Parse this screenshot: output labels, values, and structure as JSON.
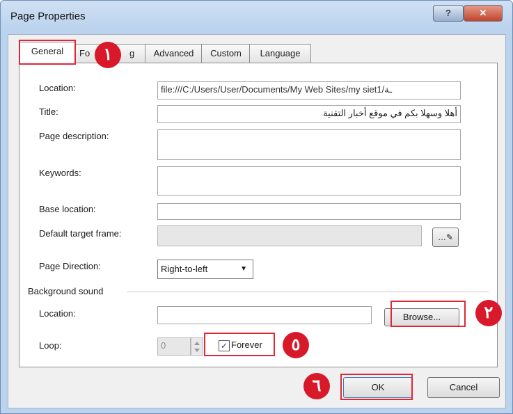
{
  "window": {
    "title": "Page Properties",
    "help_glyph": "?",
    "close_glyph": "✕"
  },
  "tabs": [
    {
      "label": "General"
    },
    {
      "label": "Formatting",
      "visible": "Fo"
    },
    {
      "label": "g"
    },
    {
      "label": "Advanced"
    },
    {
      "label": "Custom"
    },
    {
      "label": "Language"
    }
  ],
  "general": {
    "location_label": "Location:",
    "location_value": "file:///C:/Users/User/Documents/My Web Sites/my siet1/ـة",
    "title_label": "Title:",
    "title_value": "أهلا وسهلا بكم في موقع أخبار التقنية",
    "description_label": "Page description:",
    "description_value": "",
    "keywords_label": "Keywords:",
    "keywords_value": "",
    "base_label": "Base location:",
    "base_value": "",
    "target_label": "Default target frame:",
    "target_value": "",
    "direction_label": "Page Direction:",
    "direction_value": "Right-to-left",
    "direction_arrow": "▼",
    "edit_glyph": "…✎"
  },
  "sound": {
    "group_label": "Background sound",
    "location_label": "Location:",
    "location_value": "",
    "browse_label": "Browse...",
    "loop_label": "Loop:",
    "loop_value": "0",
    "forever_label": "Forever",
    "forever_checked": "✓"
  },
  "footer": {
    "ok_label": "OK",
    "cancel_label": "Cancel"
  },
  "markers": {
    "m1": "١",
    "m2": "٢",
    "m5": "٥",
    "m6": "٦"
  },
  "colors": {
    "marker": "#d8192a",
    "highlight": "#e0273a",
    "title_bg": "#bcd3ee"
  }
}
